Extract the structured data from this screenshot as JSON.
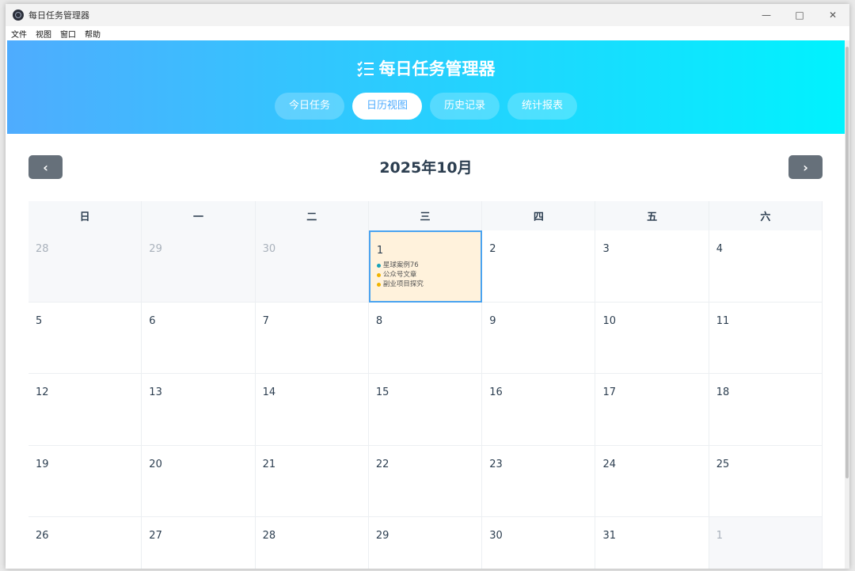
{
  "window": {
    "title": "每日任务管理器"
  },
  "menu": [
    "文件",
    "视图",
    "窗口",
    "帮助"
  ],
  "header": {
    "icon": "checklist-icon",
    "title": "每日任务管理器"
  },
  "nav": [
    {
      "label": "今日任务",
      "active": false
    },
    {
      "label": "日历视图",
      "active": true
    },
    {
      "label": "历史记录",
      "active": false
    },
    {
      "label": "统计报表",
      "active": false
    }
  ],
  "calendar": {
    "month_title": "2025年10月",
    "weekdays": [
      "日",
      "一",
      "二",
      "三",
      "四",
      "五",
      "六"
    ],
    "days": [
      {
        "n": "28",
        "other": true
      },
      {
        "n": "29",
        "other": true
      },
      {
        "n": "30",
        "other": true
      },
      {
        "n": "1",
        "today": true,
        "tasks": [
          {
            "text": "星球案例76",
            "color": "#17a2b8"
          },
          {
            "text": "公众号文章",
            "color": "#f0b400"
          },
          {
            "text": "副业项目探究",
            "color": "#f0b400"
          }
        ]
      },
      {
        "n": "2"
      },
      {
        "n": "3"
      },
      {
        "n": "4"
      },
      {
        "n": "5"
      },
      {
        "n": "6"
      },
      {
        "n": "7"
      },
      {
        "n": "8"
      },
      {
        "n": "9"
      },
      {
        "n": "10"
      },
      {
        "n": "11"
      },
      {
        "n": "12"
      },
      {
        "n": "13"
      },
      {
        "n": "14"
      },
      {
        "n": "15"
      },
      {
        "n": "16"
      },
      {
        "n": "17"
      },
      {
        "n": "18"
      },
      {
        "n": "19"
      },
      {
        "n": "20"
      },
      {
        "n": "21"
      },
      {
        "n": "22"
      },
      {
        "n": "23"
      },
      {
        "n": "24"
      },
      {
        "n": "25"
      },
      {
        "n": "26"
      },
      {
        "n": "27"
      },
      {
        "n": "28"
      },
      {
        "n": "29"
      },
      {
        "n": "30"
      },
      {
        "n": "31"
      },
      {
        "n": "1",
        "other": true
      }
    ]
  },
  "colors": {
    "gradient_start": "#4facfe",
    "gradient_end": "#00f2fe",
    "today_bg": "#fff2dc",
    "today_border": "#4aa3f0"
  }
}
